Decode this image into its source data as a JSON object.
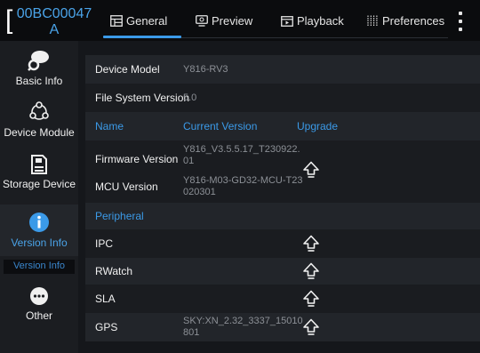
{
  "header": {
    "device_id_line1": "00BC00047",
    "device_id_line2": "A",
    "tabs": [
      {
        "label": "General",
        "icon": "general-grid-icon"
      },
      {
        "label": "Preview",
        "icon": "preview-monitor-icon"
      },
      {
        "label": "Playback",
        "icon": "playback-calendar-icon"
      },
      {
        "label": "Preferences",
        "icon": "preferences-sliders-icon"
      }
    ],
    "active_tab": "General",
    "more_icon": "more-vertical-icon"
  },
  "sidebar": {
    "items": [
      {
        "label": "Basic Info",
        "icon": "basic-info-icon"
      },
      {
        "label": "Device Module",
        "icon": "device-module-icon"
      },
      {
        "label": "Storage Device",
        "icon": "storage-device-icon"
      },
      {
        "label": "Version Info",
        "icon": "version-info-icon",
        "active": true
      },
      {
        "label": "Other",
        "icon": "other-dots-icon"
      }
    ],
    "ghost_label": "Version Info"
  },
  "main": {
    "device_model": {
      "label": "Device Model",
      "value": "Y816-RV3"
    },
    "fs_version": {
      "label": "File System Version",
      "value": "5.0"
    },
    "table_headers": {
      "name": "Name",
      "current": "Current Version",
      "upgrade": "Upgrade"
    },
    "firmware": {
      "label": "Firmware Version",
      "value_line1": "Y816_V3.5.5.17_T230922.",
      "value_line2": "01"
    },
    "mcu": {
      "label": "MCU Version",
      "value_line1": "Y816-M03-GD32-MCU-T23",
      "value_line2": "020301"
    },
    "peripheral_header": "Peripheral",
    "ipc": {
      "label": "IPC"
    },
    "rwatch": {
      "label": "RWatch"
    },
    "sla": {
      "label": "SLA"
    },
    "gps": {
      "label": "GPS",
      "value_line1": "SKY:XN_2.32_3337_15010",
      "value_line2": "801"
    }
  },
  "colors": {
    "accent": "#3b9ae8",
    "background": "#15171b",
    "sidebar": "#1b1d21",
    "row_shade": "#22252a"
  }
}
